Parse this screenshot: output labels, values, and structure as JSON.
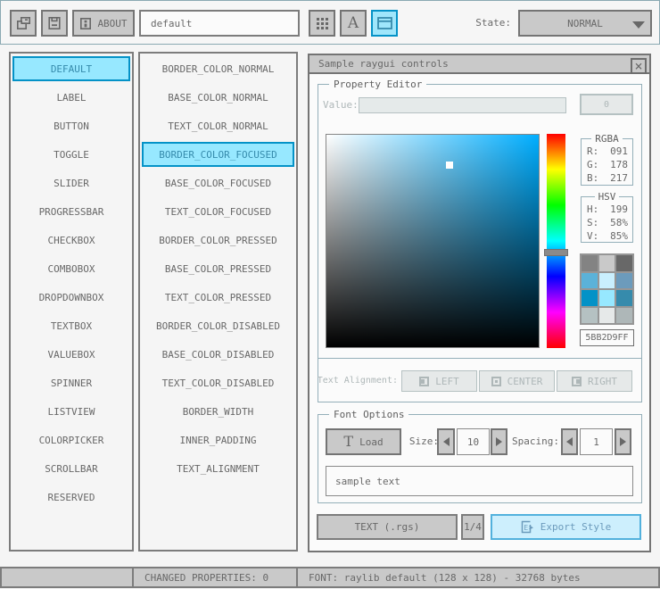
{
  "toolbar": {
    "about_label": "ABOUT",
    "style_name": "default",
    "state_label": "State:",
    "state_value": "NORMAL"
  },
  "controls": {
    "selected": "DEFAULT",
    "items": [
      "DEFAULT",
      "LABEL",
      "BUTTON",
      "TOGGLE",
      "SLIDER",
      "PROGRESSBAR",
      "CHECKBOX",
      "COMBOBOX",
      "DROPDOWNBOX",
      "TEXTBOX",
      "VALUEBOX",
      "SPINNER",
      "LISTVIEW",
      "COLORPICKER",
      "SCROLLBAR",
      "RESERVED"
    ]
  },
  "properties": {
    "selected": "BORDER_COLOR_FOCUSED",
    "items": [
      "BORDER_COLOR_NORMAL",
      "BASE_COLOR_NORMAL",
      "TEXT_COLOR_NORMAL",
      "BORDER_COLOR_FOCUSED",
      "BASE_COLOR_FOCUSED",
      "TEXT_COLOR_FOCUSED",
      "BORDER_COLOR_PRESSED",
      "BASE_COLOR_PRESSED",
      "TEXT_COLOR_PRESSED",
      "BORDER_COLOR_DISABLED",
      "BASE_COLOR_DISABLED",
      "TEXT_COLOR_DISABLED",
      "BORDER_WIDTH",
      "INNER_PADDING",
      "TEXT_ALIGNMENT"
    ]
  },
  "window": {
    "title": "Sample raygui controls",
    "close_label": "×",
    "property_editor": {
      "title": "Property Editor",
      "value_label": "Value:",
      "value_text": "",
      "value_button_label": "0"
    },
    "rgba": {
      "title": "RGBA",
      "rows": [
        {
          "label": "R:",
          "value": "091"
        },
        {
          "label": "G:",
          "value": "178"
        },
        {
          "label": "B:",
          "value": "217"
        }
      ]
    },
    "hsv": {
      "title": "HSV",
      "rows": [
        {
          "label": "H:",
          "value": "199"
        },
        {
          "label": "S:",
          "value": "58%"
        },
        {
          "label": "V:",
          "value": "85%"
        }
      ]
    },
    "hex_value": "5BB2D9FF",
    "style_palette": [
      "#838383",
      "#c9c9c9",
      "#686868",
      "#5bb2d9",
      "#c9effe",
      "#6c9bbc",
      "#0492c7",
      "#97e8ff",
      "#368bac",
      "#b5c1c2",
      "#e6e9e9",
      "#aeb7b8"
    ],
    "text_alignment": {
      "label": "Text Alignment:",
      "options": [
        "LEFT",
        "CENTER",
        "RIGHT"
      ]
    },
    "font_options": {
      "title": "Font Options",
      "load_icon": "T",
      "load_label": "Load",
      "size_label": "Size:",
      "size_value": "10",
      "spacing_label": "Spacing:",
      "spacing_value": "1",
      "sample_text": "sample text"
    },
    "footer": {
      "format_button": "TEXT (.rgs)",
      "page_indicator": "1/4",
      "export_button": "Export Style"
    }
  },
  "color_picker": {
    "hue": 199,
    "saturation_pct": 58,
    "value_pct": 85,
    "rgb": [
      91,
      178,
      217
    ],
    "hex": "5BB2D9FF"
  },
  "status_bar": {
    "changed_properties": "CHANGED PROPERTIES: 0",
    "font_info": "FONT: raylib default (128 x 128) - 32768 bytes"
  },
  "colors": {
    "background": "#f5f5f5",
    "border_normal": "#838383",
    "base_normal": "#c9c9c9",
    "text_normal": "#686868",
    "border_focused": "#5bb2d9",
    "base_focused": "#c9effe",
    "text_focused": "#6c9bbc",
    "border_pressed": "#0492c7",
    "base_pressed": "#97e8ff",
    "text_pressed": "#368bac",
    "border_disabled": "#b5c1c2",
    "base_disabled": "#e6e9e9",
    "text_disabled": "#aeb7b8",
    "line": "#90abb5"
  }
}
